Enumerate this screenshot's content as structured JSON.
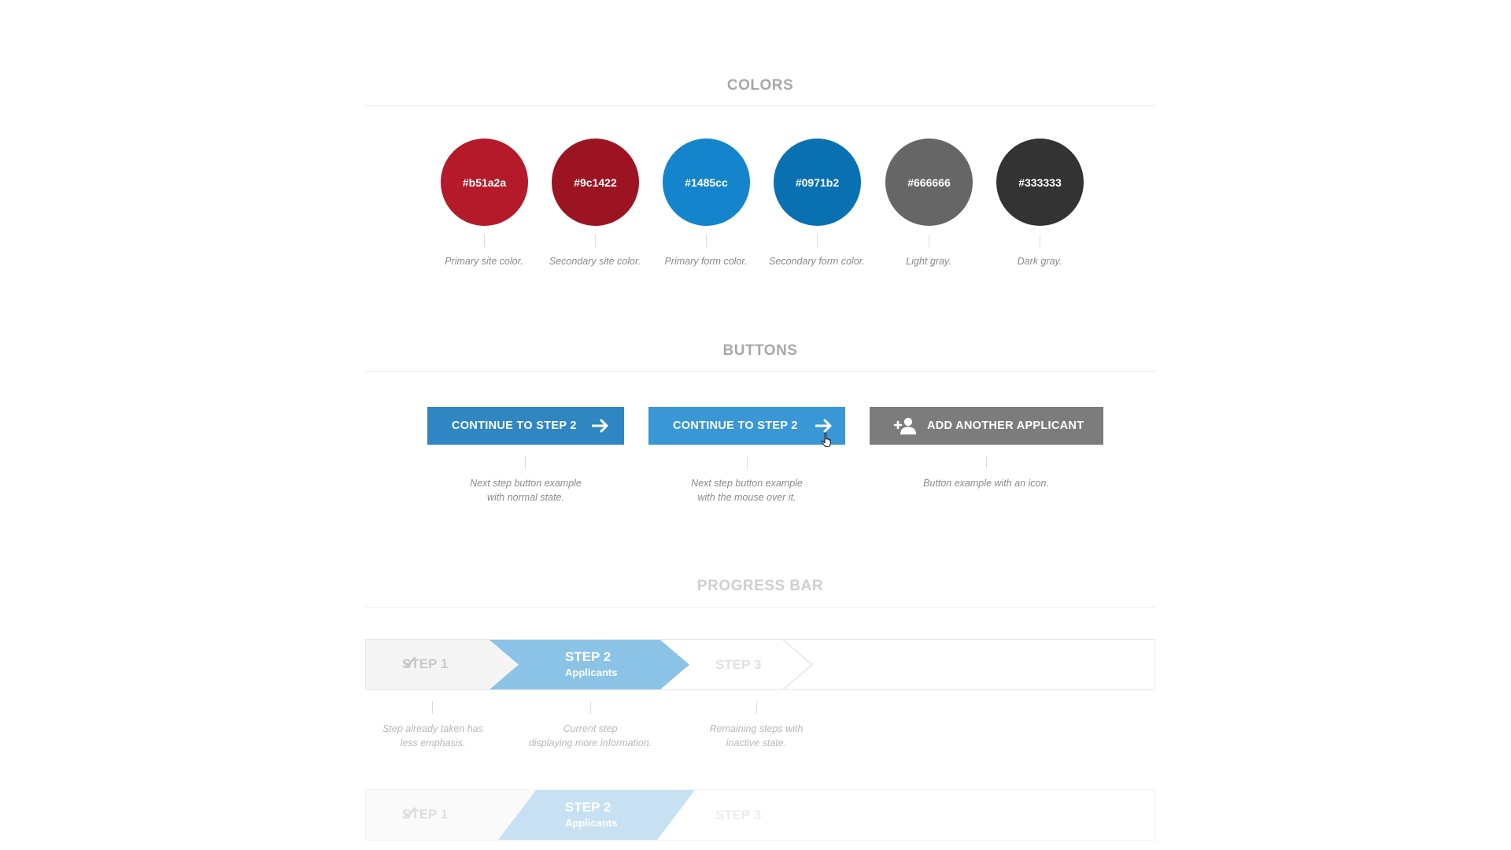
{
  "sections": {
    "colors_title": "COLORS",
    "buttons_title": "BUTTONS",
    "progress_title": "PROGRESS BAR"
  },
  "colors": [
    {
      "hex": "#b51a2a",
      "caption": "Primary site color.",
      "bg": "#b51a2a"
    },
    {
      "hex": "#9c1422",
      "caption": "Secondary site color.",
      "bg": "#9c1422"
    },
    {
      "hex": "#1485cc",
      "caption": "Primary form color.",
      "bg": "#1485cc"
    },
    {
      "hex": "#0971b2",
      "caption": "Secondary form color.",
      "bg": "#0971b2"
    },
    {
      "hex": "#666666",
      "caption": "Light gray.",
      "bg": "#666666"
    },
    {
      "hex": "#333333",
      "caption": "Dark gray.",
      "bg": "#333333"
    }
  ],
  "buttons": {
    "normal": {
      "label": "CONTINUE TO STEP 2",
      "color": "#2f86c3",
      "icon": "arrow-right-icon",
      "caption_1": "Next step button example",
      "caption_2": "with normal state."
    },
    "hover": {
      "label": "CONTINUE TO STEP 2",
      "color": "#3a97d6",
      "icon": "arrow-right-icon",
      "caption_1": "Next step button example",
      "caption_2": "with the mouse over it."
    },
    "icon": {
      "label": "ADD ANOTHER APPLICANT",
      "color": "#7c7c7c",
      "icon": "add-user-icon",
      "caption": "Button example with an icon."
    }
  },
  "progress": {
    "step1": "STEP 1",
    "step2": "STEP 2",
    "step2_sub": "Applicants",
    "step3": "STEP 3",
    "check_icon": "check-icon",
    "active_color": "#8bc3e6",
    "faded_active_color": "#c7e1f3",
    "captions": {
      "done_1": "Step already taken has",
      "done_2": "less emphasis.",
      "current_1": "Current step",
      "current_2": "displaying more information.",
      "remaining_1": "Remaining steps with",
      "remaining_2": "inactive state."
    }
  }
}
